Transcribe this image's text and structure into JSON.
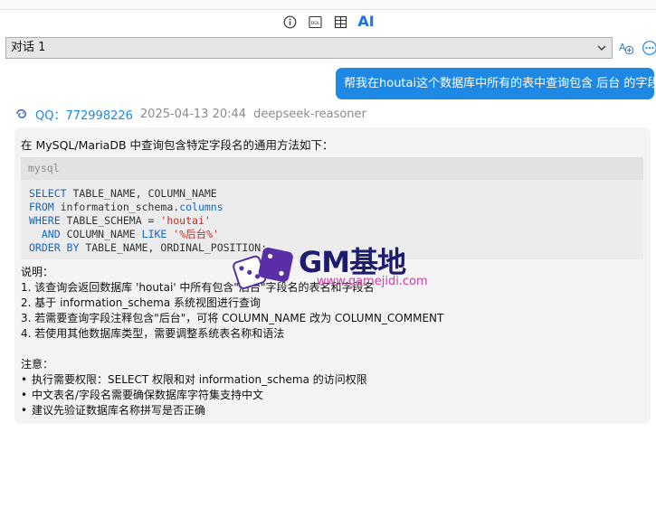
{
  "toolbar": {
    "ai_label": "AI",
    "info_icon": "info-circle-icon",
    "ddl_icon": "ddl-icon",
    "layout_icon": "layout-icon"
  },
  "conversation": {
    "selected": "对话 1",
    "add_icon": "add-conversation-icon",
    "more_icon": "more-icon"
  },
  "user_message": "帮我在houtai这个数据库中所有的表中查询包含 后台 的字段",
  "reply_meta": {
    "sender": "QQ：772998226",
    "timestamp": "2025-04-13 20:44",
    "model": "deepseek-reasoner"
  },
  "reply": {
    "intro": "在 MySQL/MariaDB 中查询包含特定字段名的通用方法如下：",
    "code_lang": "mysql",
    "code_lines": [
      "SELECT TABLE_NAME, COLUMN_NAME",
      "FROM information_schema.columns",
      "WHERE TABLE_SCHEMA = 'houtai'",
      "  AND COLUMN_NAME LIKE '%后台%'",
      "ORDER BY TABLE_NAME, ORDINAL_POSITION;"
    ],
    "explain_title": "说明：",
    "explain_items": [
      "1. 该查询会返回数据库 'houtai' 中所有包含\"后台\"字段名的表名和字段名",
      "2. 基于 information_schema 系统视图进行查询",
      "3. 若需要查询字段注释包含\"后台\"，可将 COLUMN_NAME 改为 COLUMN_COMMENT",
      "4. 若使用其他数据库类型，需要调整系统表名称和语法"
    ],
    "note_title": "注意：",
    "note_items": [
      "执行需要权限：SELECT 权限和对 information_schema 的访问权限",
      "中文表名/字段名需要确保数据库字符集支持中文",
      "建议先验证数据库名称拼写是否正确"
    ],
    "bullet": "•"
  },
  "watermark": {
    "title": "GM基地",
    "url": "www.gamejidi.com"
  },
  "colors": {
    "accent": "#1e88e5",
    "keyword": "#1565c0",
    "string": "#c62828"
  }
}
